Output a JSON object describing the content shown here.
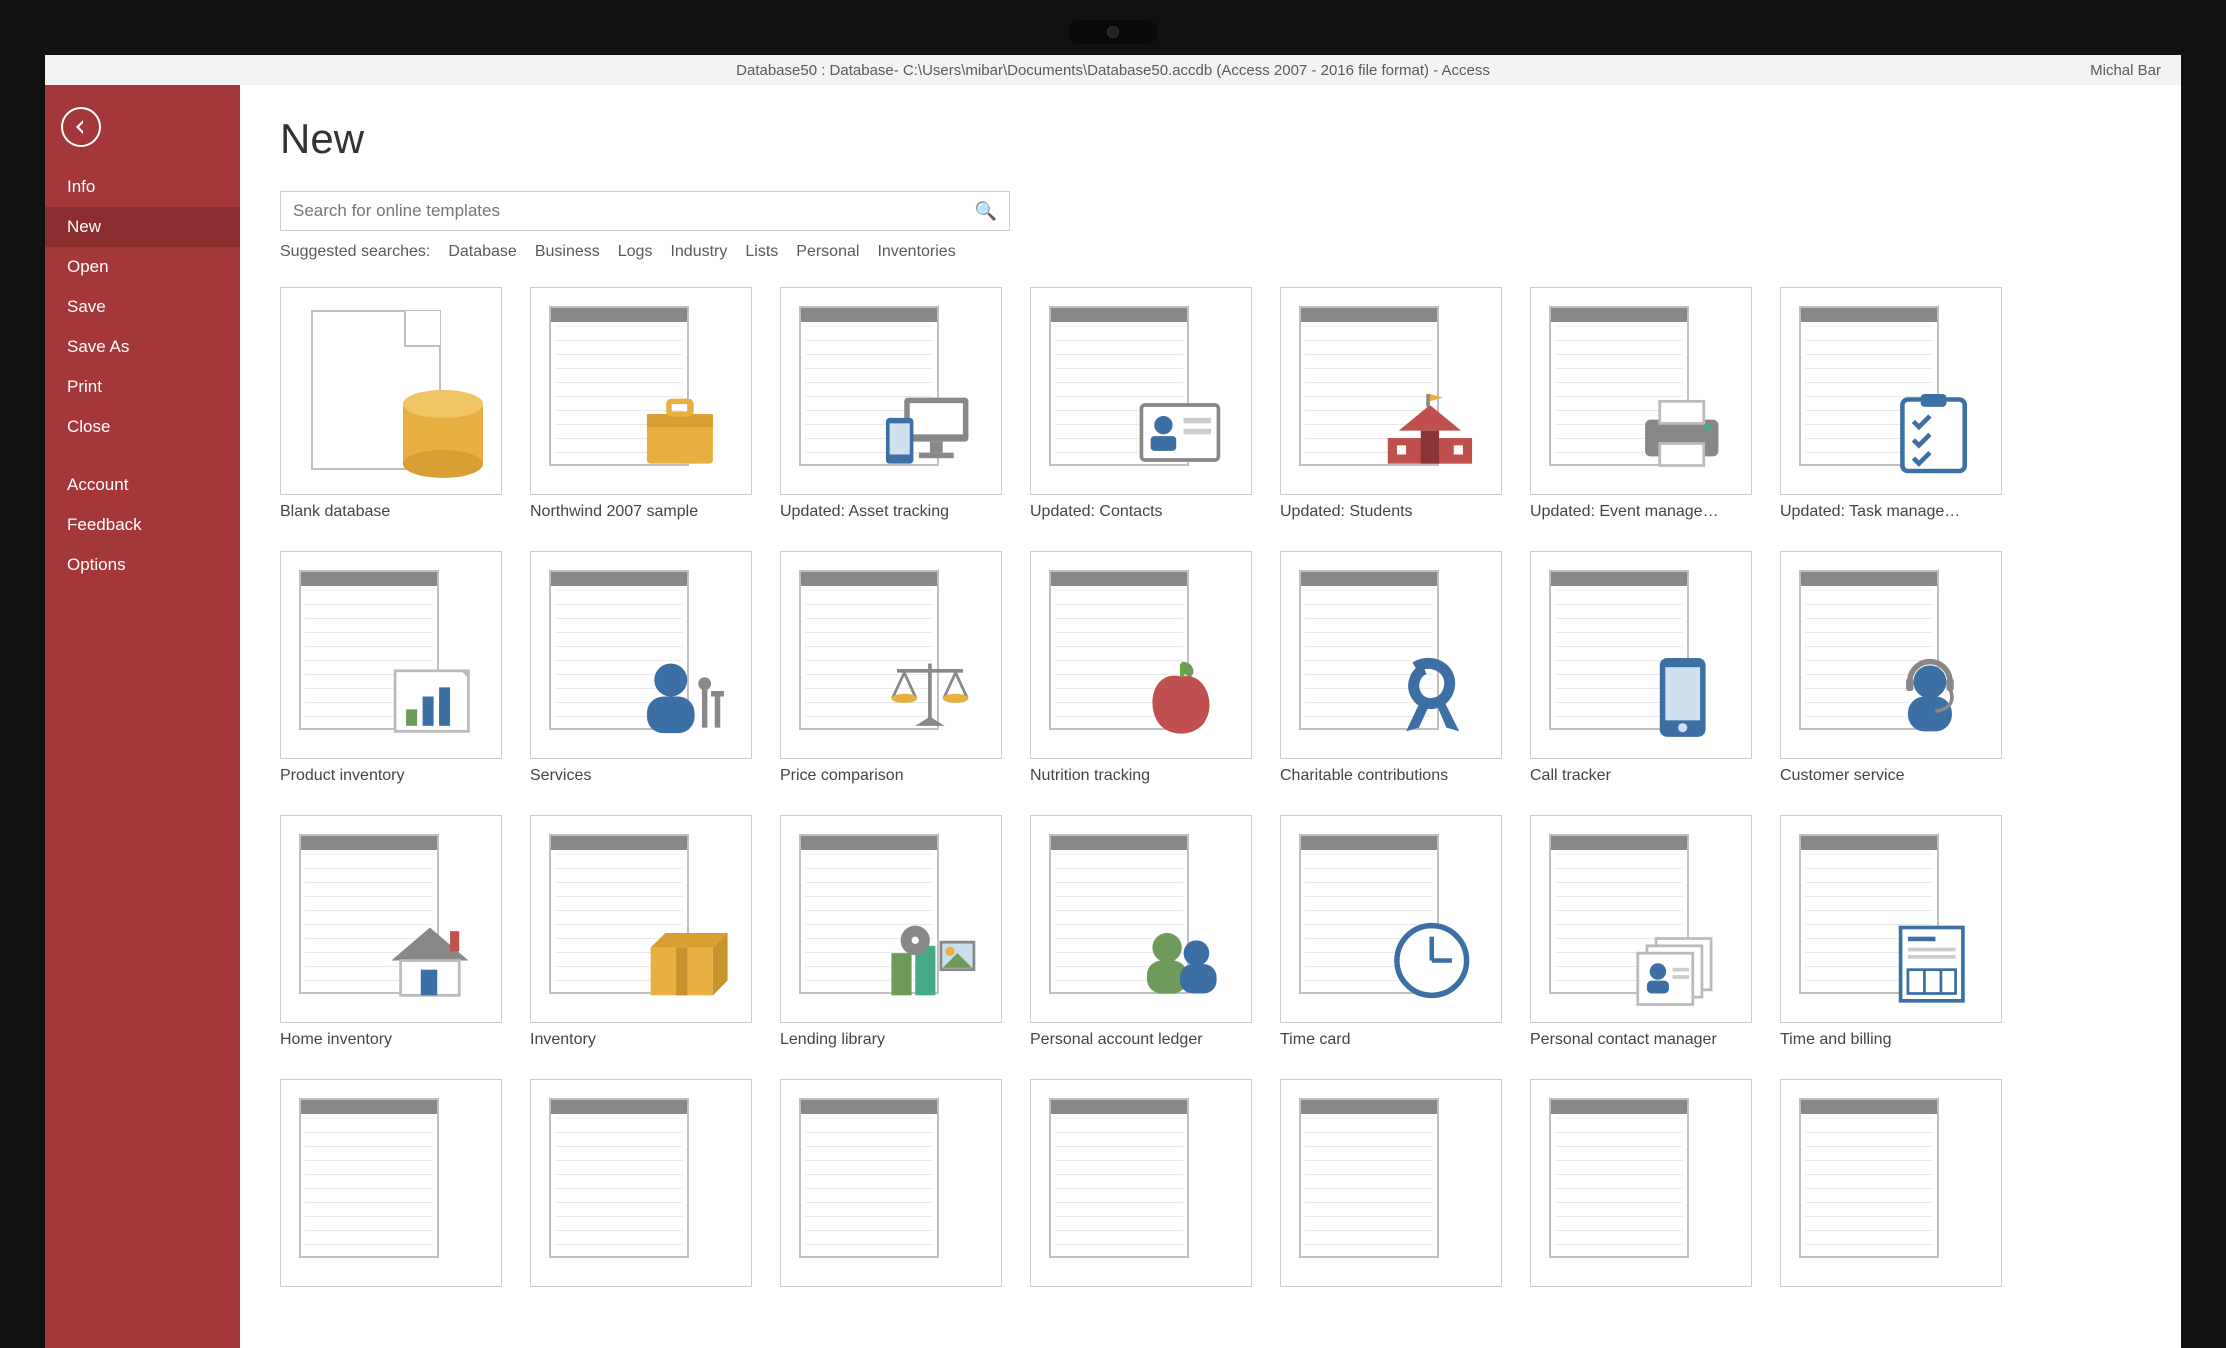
{
  "titlebar": {
    "path": "Database50 : Database- C:\\Users\\mibar\\Documents\\Database50.accdb (Access 2007 - 2016 file format)  -  Access",
    "user": "Michal Bar"
  },
  "sidebar": {
    "items": [
      {
        "id": "info",
        "label": "Info"
      },
      {
        "id": "new",
        "label": "New",
        "selected": true
      },
      {
        "id": "open",
        "label": "Open"
      },
      {
        "id": "save",
        "label": "Save"
      },
      {
        "id": "saveas",
        "label": "Save As"
      },
      {
        "id": "print",
        "label": "Print"
      },
      {
        "id": "close",
        "label": "Close"
      }
    ],
    "footer": [
      {
        "id": "account",
        "label": "Account"
      },
      {
        "id": "feedback",
        "label": "Feedback"
      },
      {
        "id": "options",
        "label": "Options"
      }
    ]
  },
  "page": {
    "title": "New",
    "search_placeholder": "Search for online templates",
    "suggested_label": "Suggested searches:",
    "suggested": [
      "Database",
      "Business",
      "Logs",
      "Industry",
      "Lists",
      "Personal",
      "Inventories"
    ]
  },
  "templates": [
    {
      "name": "Blank database",
      "icon": "blank-db"
    },
    {
      "name": "Northwind 2007 sample",
      "icon": "briefcase"
    },
    {
      "name": "Updated: Asset tracking",
      "icon": "devices"
    },
    {
      "name": "Updated: Contacts",
      "icon": "contact-card"
    },
    {
      "name": "Updated: Students",
      "icon": "school"
    },
    {
      "name": "Updated: Event manage…",
      "icon": "printer"
    },
    {
      "name": "Updated: Task manage…",
      "icon": "checklist"
    },
    {
      "name": "Product inventory",
      "icon": "bar-chart"
    },
    {
      "name": "Services",
      "icon": "worker"
    },
    {
      "name": "Price comparison",
      "icon": "scales"
    },
    {
      "name": "Nutrition tracking",
      "icon": "apple"
    },
    {
      "name": "Charitable contributions",
      "icon": "ribbon"
    },
    {
      "name": "Call tracker",
      "icon": "phone"
    },
    {
      "name": "Customer service",
      "icon": "headset"
    },
    {
      "name": "Home inventory",
      "icon": "house"
    },
    {
      "name": "Inventory",
      "icon": "box"
    },
    {
      "name": "Lending library",
      "icon": "media"
    },
    {
      "name": "Personal account ledger",
      "icon": "people"
    },
    {
      "name": "Time card",
      "icon": "clock"
    },
    {
      "name": "Personal contact manager",
      "icon": "rolodex"
    },
    {
      "name": "Time and billing",
      "icon": "invoice"
    },
    {
      "name": "",
      "icon": ""
    },
    {
      "name": "",
      "icon": ""
    },
    {
      "name": "",
      "icon": ""
    },
    {
      "name": "",
      "icon": ""
    },
    {
      "name": "",
      "icon": ""
    },
    {
      "name": "",
      "icon": ""
    },
    {
      "name": "",
      "icon": ""
    }
  ],
  "colors": {
    "accent": "#a4373a",
    "blue": "#3c70a4",
    "yellow": "#e8b040",
    "red": "#c0504d",
    "green": "#6e9a5a",
    "gray": "#888888"
  }
}
